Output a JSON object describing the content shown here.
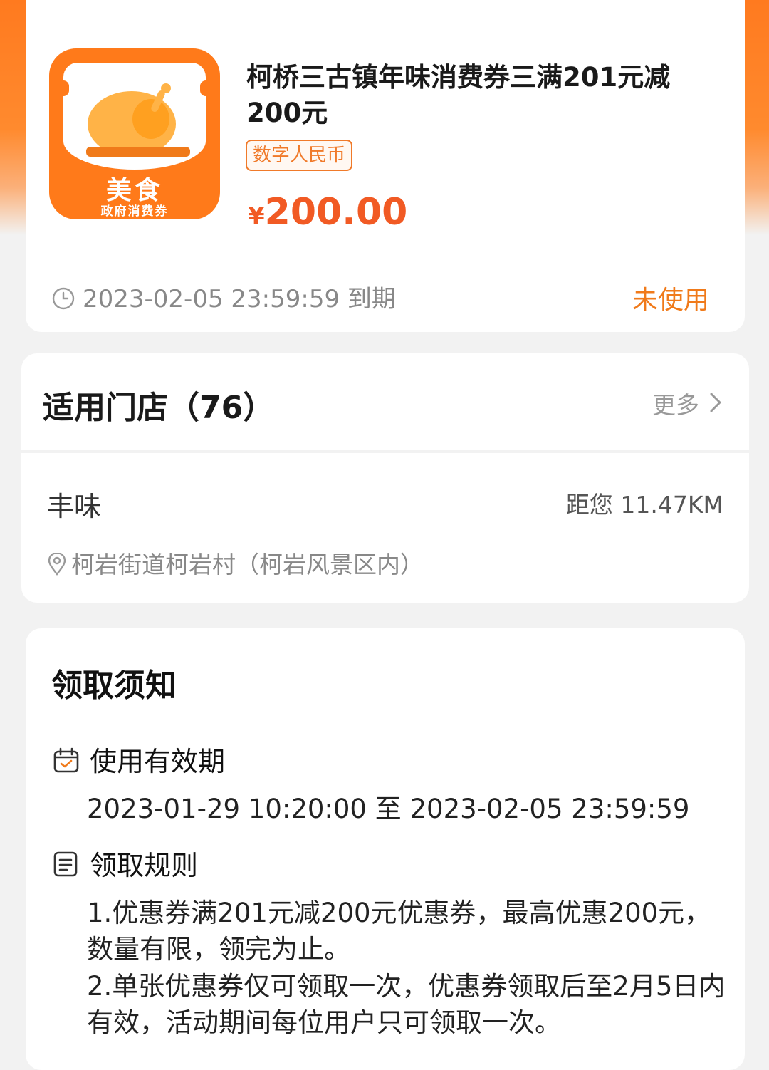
{
  "coupon": {
    "logo_main": "美食",
    "logo_sub": "政府消费券",
    "title": "柯桥三古镇年味消费券三满201元减200元",
    "tag": "数字人民币",
    "currency_symbol": "¥",
    "amount": "200.00",
    "expiry": "2023-02-05 23:59:59 到期",
    "status": "未使用",
    "colors": {
      "accent": "#f15a24",
      "brand": "#ff7a1a"
    }
  },
  "stores": {
    "title": "适用门店（76）",
    "more_label": "更多",
    "items": [
      {
        "name": "丰味",
        "distance": "距您 11.47KM",
        "address": "柯岩街道柯岩村（柯岩风景区内）"
      }
    ]
  },
  "notice": {
    "title": "领取须知",
    "validity_label": "使用有效期",
    "validity_value": "2023-01-29 10:20:00 至 2023-02-05 23:59:59",
    "rules_label": "领取规则",
    "rules": [
      "1.优惠券满201元减200元优惠券，最高优惠200元，数量有限，领完为止。",
      "2.单张优惠券仅可领取一次，优惠券领取后至2月5日内有效，活动期间每位用户只可领取一次。"
    ]
  }
}
